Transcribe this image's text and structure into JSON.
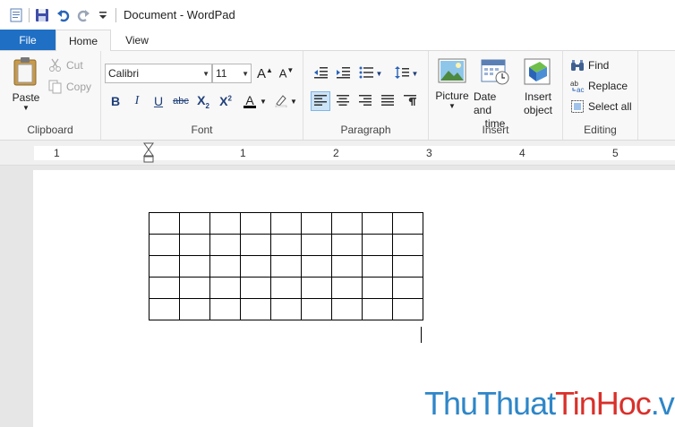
{
  "window": {
    "title": "Document - WordPad"
  },
  "tabs": [
    {
      "label": "File"
    },
    {
      "label": "Home"
    },
    {
      "label": "View"
    }
  ],
  "ribbon": {
    "clipboard": {
      "group_label": "Clipboard",
      "paste": "Paste",
      "cut": "Cut",
      "copy": "Copy"
    },
    "font": {
      "group_label": "Font",
      "family": "Calibri",
      "size": "11"
    },
    "paragraph": {
      "group_label": "Paragraph"
    },
    "insert": {
      "group_label": "Insert",
      "picture": "Picture",
      "date_time_1": "Date and",
      "date_time_2": "time",
      "object_1": "Insert",
      "object_2": "object"
    },
    "editing": {
      "group_label": "Editing",
      "find": "Find",
      "replace": "Replace",
      "select_all": "Select all"
    }
  },
  "ruler": {
    "marks": [
      "1",
      "1",
      "2",
      "3",
      "4",
      "5"
    ]
  },
  "table": {
    "rows": 5,
    "cols": 9
  },
  "watermark": {
    "part1": "ThuThuat",
    "part2": "TinHoc",
    "part3": ".vn"
  },
  "colors": {
    "accent_blue": "#1f6fc4",
    "watermark_blue": "#2e86c8",
    "watermark_red": "#d9302a"
  }
}
